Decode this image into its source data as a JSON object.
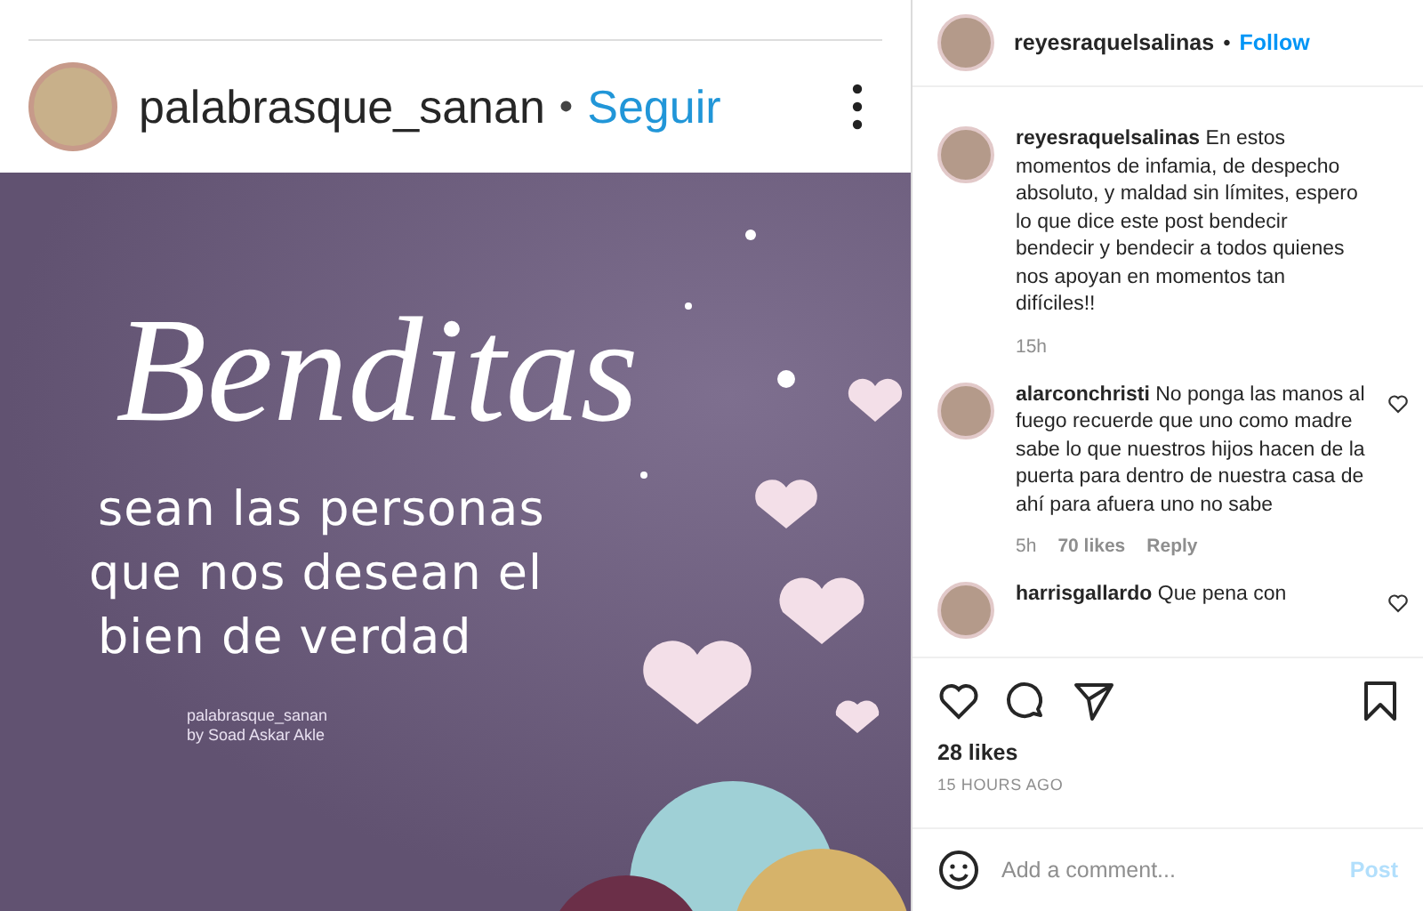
{
  "shared_post": {
    "username": "palabrasque_sanan",
    "separator": "•",
    "follow": "Seguir",
    "graphic": {
      "title": "Benditas",
      "lines": [
        "sean las personas",
        "que nos desean el",
        "bien de verdad"
      ],
      "signature": [
        "palabrasque_sanan",
        "by Soad Askar Akle"
      ]
    }
  },
  "post_header": {
    "username": "reyesraquelsalinas",
    "separator": "•",
    "follow": "Follow"
  },
  "comments": [
    {
      "username": "reyesraquelsalinas",
      "text": "En estos momentos de infamia, de despecho absoluto, y maldad sin límites, espero lo que dice este post bendecir bendecir y bendecir a todos quienes nos apoyan en momentos tan difíciles!!",
      "meta": [
        "15h"
      ],
      "likeable": false
    },
    {
      "username": "alarconchristi",
      "text": "No ponga las manos al fuego recuerde que uno como madre sabe lo que nuestros hijos hacen de la puerta para dentro de nuestra casa de ahí para afuera uno no sabe",
      "meta": [
        "5h",
        "70 likes",
        "Reply"
      ],
      "likeable": true
    },
    {
      "username": "harrisgallardo",
      "text": "Que pena con",
      "likeable": true
    }
  ],
  "likes": "28 likes",
  "time": "15 HOURS AGO",
  "comment_box": {
    "placeholder": "Add a comment...",
    "post": "Post"
  }
}
